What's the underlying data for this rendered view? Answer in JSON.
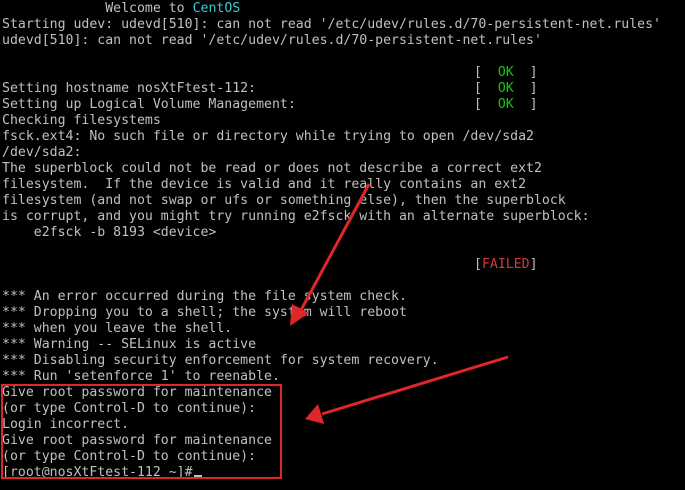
{
  "console": {
    "welcome_prefix": "             Welcome to ",
    "welcome_brand": "CentOS",
    "lines": [
      "Starting udev: udevd[510]: can not read '/etc/udev/rules.d/70-persistent-net.rules'",
      "udevd[510]: can not read '/etc/udev/rules.d/70-persistent-net.rules'",
      "Setting hostname nosXtFtest-112:",
      "Setting up Logical Volume Management:",
      "Checking filesystems",
      "fsck.ext4: No such file or directory while trying to open /dev/sda2",
      "/dev/sda2:",
      "The superblock could not be read or does not describe a correct ext2",
      "filesystem.  If the device is valid and it really contains an ext2",
      "filesystem (and not swap or ufs or something else), then the superblock",
      "is corrupt, and you might try running e2fsck with an alternate superblock:",
      "    e2fsck -b 8193 <device>",
      "*** An error occurred during the file system check.",
      "*** Dropping you to a shell; the system will reboot",
      "*** when you leave the shell.",
      "*** Warning -- SELinux is active",
      "*** Disabling security enforcement for system recovery.",
      "*** Run 'setenforce 1' to reenable.",
      "Give root password for maintenance",
      "(or type Control-D to continue):",
      "Login incorrect.",
      "Give root password for maintenance",
      "(or type Control-D to continue):",
      "[root@nosXtFtest-112 ~]#"
    ],
    "status_ok": "OK",
    "status_failed": "FAILED"
  },
  "colors": {
    "background": "#000000",
    "text": "#c0c0c0",
    "ok": "#18c418",
    "failed": "#d23a3a",
    "brand": "#3ec8d8",
    "annotation": "#e0262b"
  }
}
